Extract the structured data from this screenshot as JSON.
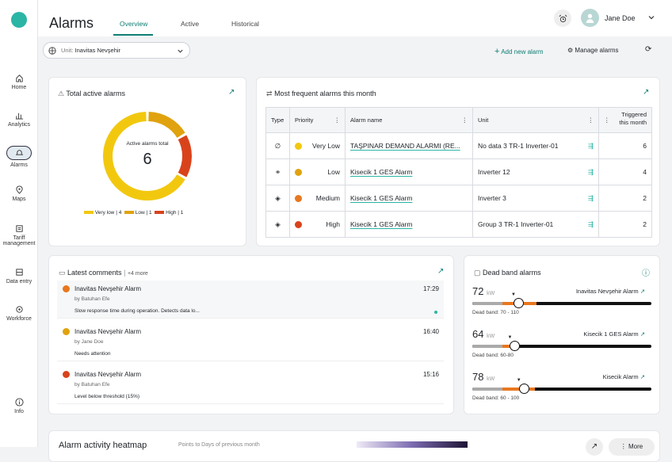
{
  "app": {
    "title": "Alarms"
  },
  "tabs": [
    "Overview",
    "Active",
    "Historical"
  ],
  "user": {
    "name": "Jane Doe"
  },
  "sidebar": [
    {
      "label": "Home"
    },
    {
      "label": "Analytics"
    },
    {
      "label": "Alarms"
    },
    {
      "label": "Maps"
    },
    {
      "label": "Tariff",
      "label2": "management"
    },
    {
      "label": "Data entry"
    },
    {
      "label": "Workforce"
    },
    {
      "label": "Info"
    }
  ],
  "unit": {
    "prefix": "Unit:",
    "value": "Inavitas Nevşehir"
  },
  "actions": {
    "add": "Add new alarm",
    "manage": "Manage alarms"
  },
  "total": {
    "title": "Total active alarms",
    "center_label": "Active alarms total",
    "count": "6",
    "legend": [
      {
        "label": "Very low",
        "count": "4",
        "color": "#f2c80f"
      },
      {
        "label": "Low",
        "count": "1",
        "color": "#e0a20e"
      },
      {
        "label": "High",
        "count": "1",
        "color": "#d9431c"
      }
    ],
    "shares": [
      4,
      1,
      1
    ]
  },
  "frequent": {
    "title": "Most frequent alarms this month",
    "headers": [
      "Type",
      "Priority",
      "Alarm name",
      "Unit",
      "Triggered",
      "this month"
    ],
    "rows": [
      {
        "type": "∅",
        "priority": "Very Low",
        "color": "#f2c80f",
        "name": "TAŞPINAR DEMAND ALARMI (RE...",
        "unit": "No data 3 TR-1 Inverter-01",
        "count": "6"
      },
      {
        "type": "⚭",
        "priority": "Low",
        "color": "#e0a20e",
        "name": "Kisecik 1 GES Alarm",
        "unit": "Inverter 12",
        "count": "4"
      },
      {
        "type": "◈",
        "priority": "Medium",
        "color": "#e8771e",
        "name": "Kisecik 1 GES Alarm",
        "unit": "Inverter 3",
        "count": "2"
      },
      {
        "type": "◈",
        "priority": "High",
        "color": "#d9431c",
        "name": "Kisecik 1 GES Alarm",
        "unit": "Group 3 TR-1 Inverter-01",
        "count": "2"
      }
    ]
  },
  "comments": {
    "title": "Latest comments",
    "more": "+4 more",
    "items": [
      {
        "title": "Inavitas Nevşehir Alarm",
        "by": "by Batuhan Efe",
        "text": "Slow response time during operation. Detects data lo...",
        "time": "17:29",
        "color": "#e8771e"
      },
      {
        "title": "Inavitas Nevşehir Alarm",
        "by": "by Jane Doe",
        "text": "Needs attention",
        "time": "16:40",
        "color": "#e0a20e"
      },
      {
        "title": "Inavitas Nevşehir Alarm",
        "by": "by Batuhan Efe",
        "text": "Level below threshold (15%)",
        "time": "15:16",
        "color": "#d9431c"
      }
    ]
  },
  "deadband": {
    "title": "Dead band alarms",
    "unit": "kW",
    "items": [
      {
        "value": "72",
        "name": "Inavitas Nevşehir Alarm",
        "band": "Dead band: 70 - 110",
        "pos": 0.23,
        "lo": 0.17,
        "hi": 0.36
      },
      {
        "value": "64",
        "name": "Kisecik 1 GES Alarm",
        "band": "Dead band: 60-80",
        "pos": 0.21,
        "lo": 0.17,
        "hi": 0.26
      },
      {
        "value": "78",
        "name": "Kisecik Alarm",
        "band": "Dead band: 60 - 100",
        "pos": 0.26,
        "lo": 0.17,
        "hi": 0.35
      }
    ]
  },
  "heatmap": {
    "title": "Alarm activity heatmap",
    "subtitle": "Points to Days of previous month",
    "more": "More"
  }
}
